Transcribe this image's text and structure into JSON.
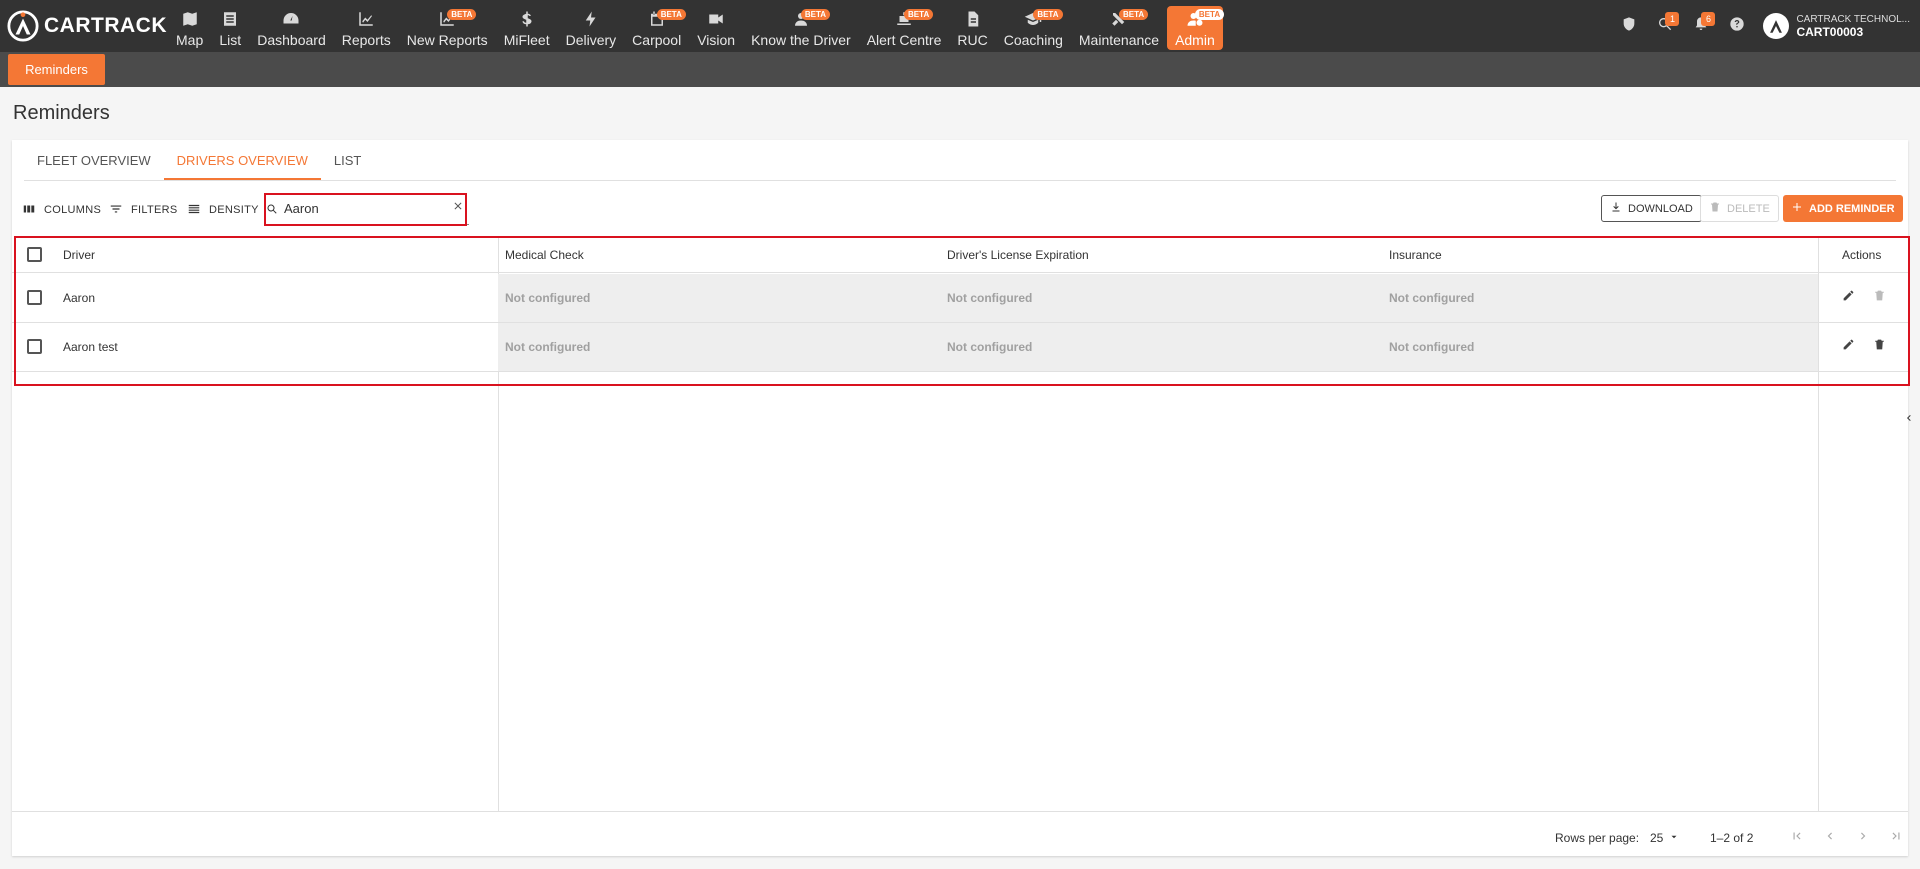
{
  "brand": {
    "name": "CARTRACK"
  },
  "nav": [
    {
      "label": "Map",
      "icon": "map-icon",
      "beta": ""
    },
    {
      "label": "List",
      "icon": "list-icon",
      "beta": ""
    },
    {
      "label": "Dashboard",
      "icon": "dashboard-icon",
      "beta": ""
    },
    {
      "label": "Reports",
      "icon": "reports-icon",
      "beta": ""
    },
    {
      "label": "New Reports",
      "icon": "new-reports-icon",
      "beta": "BETA"
    },
    {
      "label": "MiFleet",
      "icon": "dollar-icon",
      "beta": ""
    },
    {
      "label": "Delivery",
      "icon": "bolt-icon",
      "beta": ""
    },
    {
      "label": "Carpool",
      "icon": "calendar-icon",
      "beta": "BETA"
    },
    {
      "label": "Vision",
      "icon": "camera-icon",
      "beta": ""
    },
    {
      "label": "Know the Driver",
      "icon": "person-icon",
      "beta": "BETA"
    },
    {
      "label": "Alert Centre",
      "icon": "alert-icon",
      "beta": "BETA"
    },
    {
      "label": "RUC",
      "icon": "document-icon",
      "beta": ""
    },
    {
      "label": "Coaching",
      "icon": "graduation-cap-icon",
      "beta": "BETA"
    },
    {
      "label": "Maintenance",
      "icon": "tools-icon",
      "beta": "BETA"
    },
    {
      "label": "Admin",
      "icon": "admin-icon",
      "beta": "BETA"
    }
  ],
  "header_right": {
    "search_badge": "1",
    "notification_badge": "6",
    "account_company": "CARTRACK TECHNOL...",
    "account_id": "CART00003"
  },
  "subbar": {
    "tab": "Reminders"
  },
  "page": {
    "title": "Reminders"
  },
  "tabs": [
    "FLEET OVERVIEW",
    "DRIVERS OVERVIEW",
    "LIST"
  ],
  "active_tab": "DRIVERS OVERVIEW",
  "toolbar": {
    "columns": "COLUMNS",
    "filters": "FILTERS",
    "density": "DENSITY",
    "search_value": "Aaron",
    "download": "DOWNLOAD",
    "delete": "DELETE",
    "add_reminder": "ADD REMINDER"
  },
  "table": {
    "columns": [
      "Driver",
      "Medical Check",
      "Driver's License Expiration",
      "Insurance",
      "Actions"
    ],
    "rows": [
      {
        "driver": "Aaron",
        "medical": "Not configured",
        "license": "Not configured",
        "insurance": "Not configured"
      },
      {
        "driver": "Aaron test",
        "medical": "Not configured",
        "license": "Not configured",
        "insurance": "Not configured"
      }
    ]
  },
  "pagination": {
    "rows_per_page_label": "Rows per page:",
    "rows_per_page": "25",
    "range": "1–2 of 2"
  },
  "colors": {
    "accent": "#f47735",
    "nav_bg": "#333333",
    "highlight": "#d9121f"
  }
}
